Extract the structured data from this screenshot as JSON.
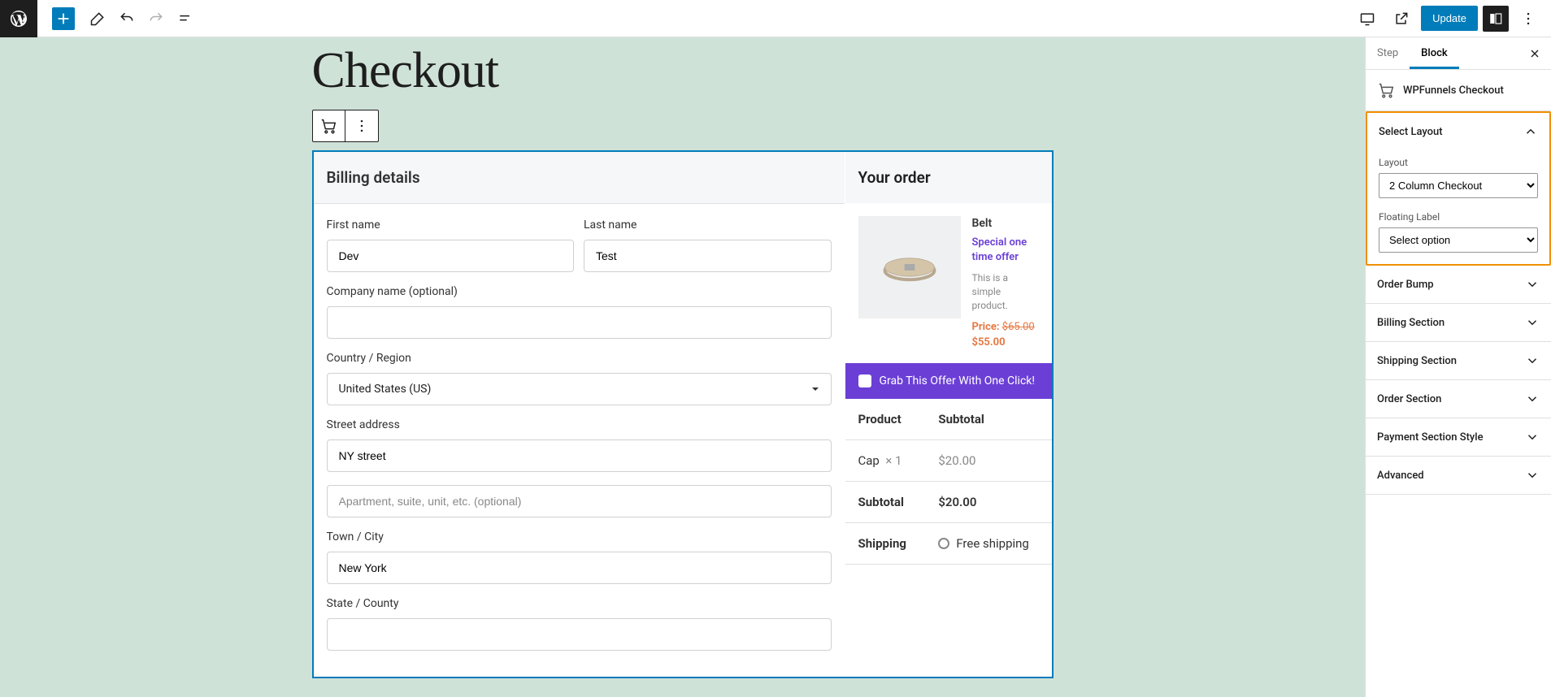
{
  "toolbar": {
    "update_btn": "Update"
  },
  "page": {
    "title": "Checkout"
  },
  "billing": {
    "heading": "Billing details",
    "first_name_label": "First name",
    "first_name_value": "Dev",
    "last_name_label": "Last name",
    "last_name_value": "Test",
    "company_label": "Company name (optional)",
    "company_value": "",
    "country_label": "Country / Region",
    "country_value": "United States (US)",
    "street_label": "Street address",
    "street_value": "NY street",
    "apartment_placeholder": "Apartment, suite, unit, etc. (optional)",
    "town_label": "Town / City",
    "town_value": "New York",
    "state_label": "State / County"
  },
  "order": {
    "heading": "Your order",
    "product_name": "Belt",
    "offer_text": "Special one time offer",
    "product_desc": "This is a simple product.",
    "price_label": "Price:",
    "price_old": "$65.00",
    "price_new": "$55.00",
    "grab_text": "Grab This Offer With One Click!",
    "table_product_h": "Product",
    "table_subtotal_h": "Subtotal",
    "item_name": "Cap",
    "item_qty": "× 1",
    "item_price": "$20.00",
    "subtotal_label": "Subtotal",
    "subtotal_value": "$20.00",
    "shipping_label": "Shipping",
    "shipping_option": "Free shipping"
  },
  "sidebar": {
    "tab_step": "Step",
    "tab_block": "Block",
    "block_name": "WPFunnels Checkout",
    "panels": {
      "select_layout": {
        "title": "Select Layout",
        "layout_label": "Layout",
        "layout_value": "2 Column Checkout",
        "floating_label": "Floating Label",
        "floating_value": "Select option"
      },
      "order_bump": "Order Bump",
      "billing_section": "Billing Section",
      "shipping_section": "Shipping Section",
      "order_section": "Order Section",
      "payment_section": "Payment Section Style",
      "advanced": "Advanced"
    }
  }
}
